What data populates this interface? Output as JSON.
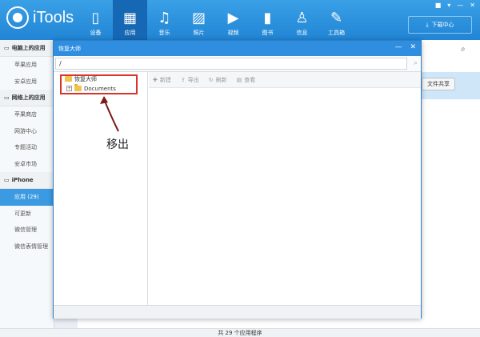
{
  "app": {
    "name": "iTools"
  },
  "window_controls": [
    "■",
    "▾",
    "—",
    "✕"
  ],
  "nav": [
    {
      "label": "设备",
      "icon": "device-icon",
      "glyph": "▯"
    },
    {
      "label": "应用",
      "icon": "apps-icon",
      "glyph": "▦",
      "active": true
    },
    {
      "label": "音乐",
      "icon": "music-icon",
      "glyph": "♫"
    },
    {
      "label": "照片",
      "icon": "photo-icon",
      "glyph": "▨"
    },
    {
      "label": "视频",
      "icon": "video-icon",
      "glyph": "▶"
    },
    {
      "label": "图书",
      "icon": "book-icon",
      "glyph": "▮"
    },
    {
      "label": "信息",
      "icon": "user-icon",
      "glyph": "♙"
    },
    {
      "label": "工具箱",
      "icon": "toolbox-icon",
      "glyph": "✎"
    }
  ],
  "download_center": "下载中心",
  "sidebar": {
    "sections": [
      {
        "title": "电脑上的应用",
        "items": [
          "苹果应用",
          "安卓应用"
        ]
      },
      {
        "title": "网络上的应用",
        "items": [
          "苹果商店",
          "网游中心",
          "专题活动",
          "安卓市场"
        ]
      },
      {
        "title": "iPhone",
        "items": [
          "应用 (29)",
          "可更新",
          "微信管理",
          "微信表情管理"
        ]
      }
    ],
    "active_item": "应用 (29)"
  },
  "background": {
    "share_button": "文件共享",
    "status": "共 29 个应用程序"
  },
  "dialog": {
    "title": "恢复大师",
    "path": "/",
    "tree": {
      "root": "恢复大师",
      "child": "Documents"
    },
    "toolbar": [
      "新建",
      "导出",
      "刷新",
      "查看"
    ]
  },
  "annotation": "移出",
  "colors": {
    "header": "#2185d5",
    "accent": "#3b9ae1",
    "highlight_box": "#d9342b"
  }
}
